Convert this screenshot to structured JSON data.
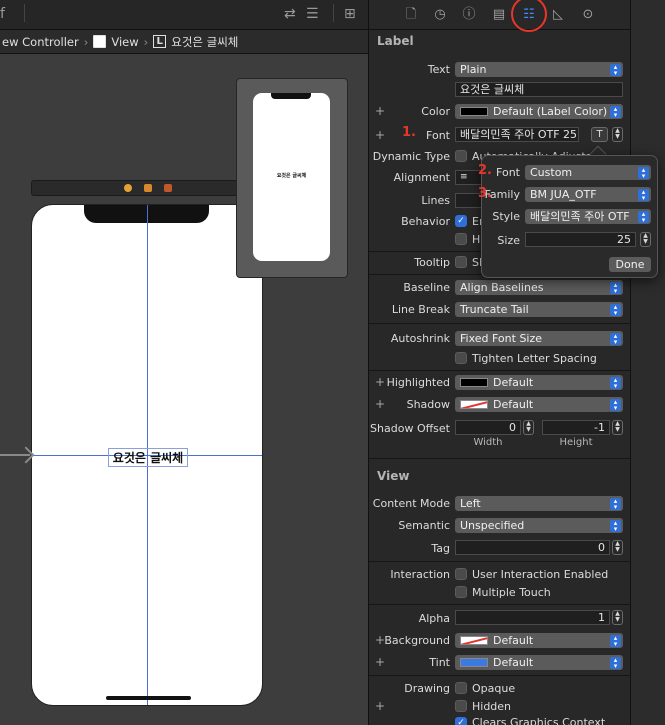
{
  "canvas": {
    "toolbar_glyph": "f",
    "breadcrumb": {
      "controller": "ew Controller",
      "view": "View",
      "label": "요것은 글씨체",
      "label_badge": "L"
    },
    "scene_label": "요것은 글씨체",
    "preview_text": "요것은 글씨체"
  },
  "inspector": {
    "label_section": "Label",
    "view_section": "View",
    "text": {
      "label": "Text",
      "value": "Plain",
      "content": "요것은 글씨체"
    },
    "color": {
      "label": "Color",
      "value": "Default (Label Color)"
    },
    "font": {
      "label": "Font",
      "value": "배달의민족 주아 OTF 25.0",
      "step_marker": "1."
    },
    "dynamic_type": {
      "label": "Dynamic Type",
      "text": "Automatically Adjusts"
    },
    "alignment": {
      "label": "Alignment"
    },
    "lines": {
      "label": "Lines"
    },
    "behavior": {
      "label": "Behavior",
      "option1": "En",
      "option2": "Hi"
    },
    "tooltip": {
      "label": "Tooltip",
      "option": "Sh"
    },
    "baseline": {
      "label": "Baseline",
      "value": "Align Baselines"
    },
    "line_break": {
      "label": "Line Break",
      "value": "Truncate Tail"
    },
    "autoshrink": {
      "label": "Autoshrink",
      "value": "Fixed Font Size"
    },
    "tighten": {
      "text": "Tighten Letter Spacing"
    },
    "highlighted": {
      "label": "Highlighted",
      "value": "Default"
    },
    "shadow": {
      "label": "Shadow",
      "value": "Default"
    },
    "shadow_offset": {
      "label": "Shadow Offset",
      "width": "0",
      "height": "-1",
      "width_label": "Width",
      "height_label": "Height"
    },
    "content_mode": {
      "label": "Content Mode",
      "value": "Left"
    },
    "semantic": {
      "label": "Semantic",
      "value": "Unspecified"
    },
    "tag": {
      "label": "Tag",
      "value": "0"
    },
    "interaction": {
      "label": "Interaction",
      "opt1": "User Interaction Enabled",
      "opt2": "Multiple Touch"
    },
    "alpha": {
      "label": "Alpha",
      "value": "1"
    },
    "background": {
      "label": "Background",
      "value": "Default"
    },
    "tint": {
      "label": "Tint",
      "value": "Default"
    },
    "drawing": {
      "label": "Drawing",
      "opt1": "Opaque",
      "opt2": "Hidden",
      "opt3": "Clears Graphics Context"
    }
  },
  "popover": {
    "font": {
      "label": "Font",
      "value": "Custom",
      "marker": "2."
    },
    "family": {
      "label": "Family",
      "value": "BM JUA_OTF",
      "marker": "3."
    },
    "style": {
      "label": "Style",
      "value": "배달의민족 주아 OTF"
    },
    "size": {
      "label": "Size",
      "value": "25"
    },
    "done": "Done"
  },
  "colors": {
    "accent": "#2f6fd8",
    "annotation_red": "#e8362a",
    "tint_blue": "#3d7ae0"
  }
}
